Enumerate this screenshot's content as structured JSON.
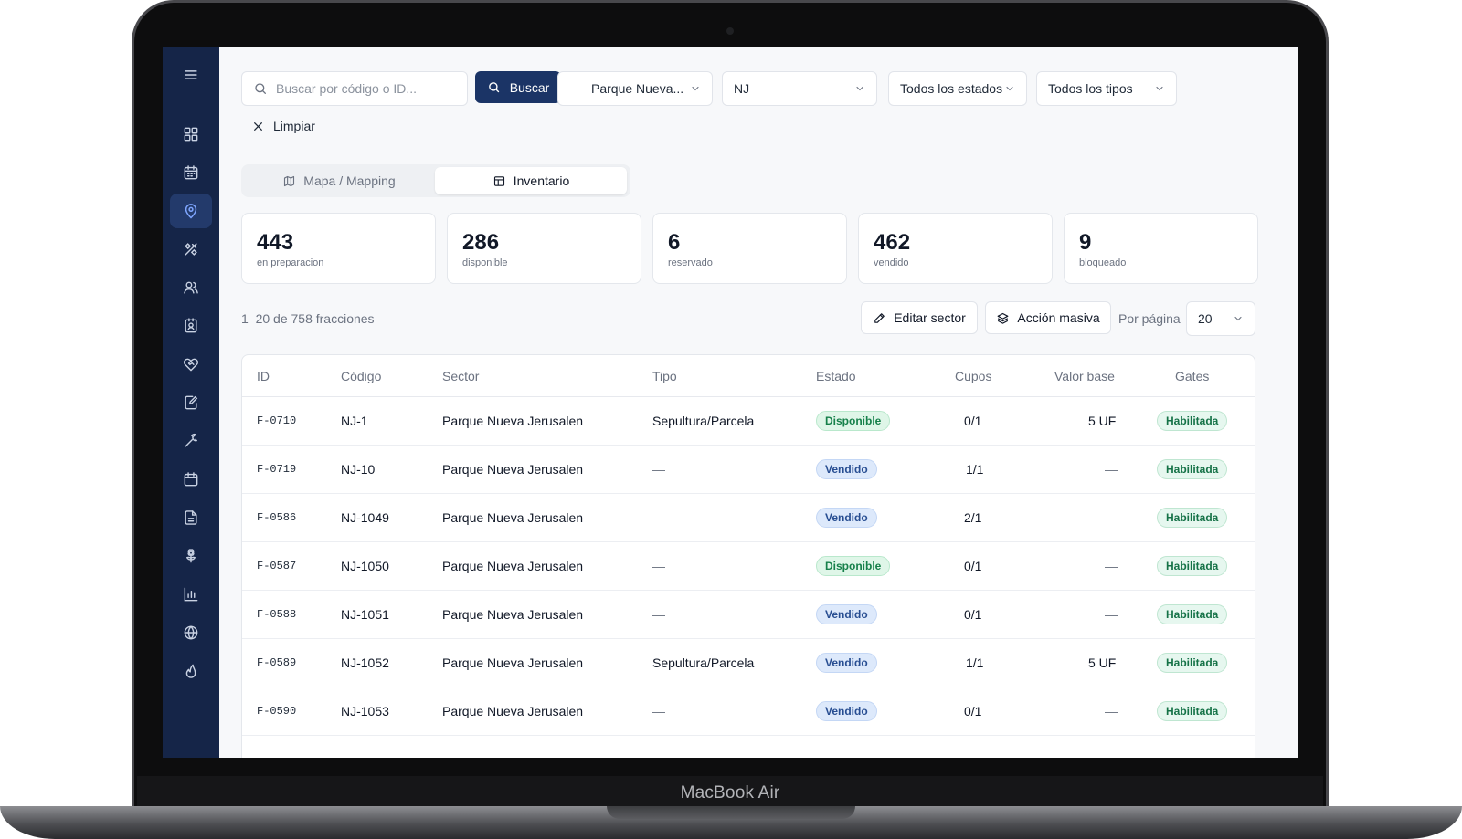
{
  "device": {
    "brand": "MacBook Air"
  },
  "sidebar": {
    "items": [
      {
        "name": "menu-icon"
      },
      {
        "name": "dashboard-icon"
      },
      {
        "name": "calendar-icon"
      },
      {
        "name": "map-pin-icon",
        "active": true
      },
      {
        "name": "tools-icon"
      },
      {
        "name": "users-icon"
      },
      {
        "name": "contact-card-icon"
      },
      {
        "name": "handshake-icon"
      },
      {
        "name": "edit-document-icon"
      },
      {
        "name": "wrench-icon"
      },
      {
        "name": "calendar-alt-icon"
      },
      {
        "name": "file-icon"
      },
      {
        "name": "flower-icon"
      },
      {
        "name": "bar-chart-icon"
      },
      {
        "name": "globe-icon"
      },
      {
        "name": "flame-icon"
      }
    ]
  },
  "filters": {
    "search_placeholder": "Buscar por código o ID...",
    "search_button": "Buscar",
    "park": "Parque Nueva...",
    "sector": "NJ",
    "status": "Todos los estados",
    "type": "Todos los tipos",
    "clear": "Limpiar"
  },
  "tabs": [
    {
      "label": "Mapa / Mapping",
      "active": false
    },
    {
      "label": "Inventario",
      "active": true
    }
  ],
  "stats": [
    {
      "value": "443",
      "label": "en preparacion"
    },
    {
      "value": "286",
      "label": "disponible"
    },
    {
      "value": "6",
      "label": "reservado"
    },
    {
      "value": "462",
      "label": "vendido"
    },
    {
      "value": "9",
      "label": "bloqueado"
    }
  ],
  "toolbar": {
    "count": "1–20 de 758 fracciones",
    "edit_sector": "Editar sector",
    "bulk_action": "Acción masiva",
    "per_page_label": "Por página",
    "per_page_value": "20"
  },
  "table": {
    "columns": [
      "ID",
      "Código",
      "Sector",
      "Tipo",
      "Estado",
      "Cupos",
      "Valor base",
      "Gates"
    ],
    "rows": [
      {
        "id": "F-0710",
        "code": "NJ-1",
        "sector": "Parque Nueva Jerusalen",
        "type": "Sepultura/Parcela",
        "status": "Disponible",
        "cupos": "0/1",
        "value": "5 UF",
        "gates": "Habilitada"
      },
      {
        "id": "F-0719",
        "code": "NJ-10",
        "sector": "Parque Nueva Jerusalen",
        "type": "—",
        "status": "Vendido",
        "cupos": "1/1",
        "value": "—",
        "gates": "Habilitada"
      },
      {
        "id": "F-0586",
        "code": "NJ-1049",
        "sector": "Parque Nueva Jerusalen",
        "type": "—",
        "status": "Vendido",
        "cupos": "2/1",
        "value": "—",
        "gates": "Habilitada"
      },
      {
        "id": "F-0587",
        "code": "NJ-1050",
        "sector": "Parque Nueva Jerusalen",
        "type": "—",
        "status": "Disponible",
        "cupos": "0/1",
        "value": "—",
        "gates": "Habilitada"
      },
      {
        "id": "F-0588",
        "code": "NJ-1051",
        "sector": "Parque Nueva Jerusalen",
        "type": "—",
        "status": "Vendido",
        "cupos": "0/1",
        "value": "—",
        "gates": "Habilitada"
      },
      {
        "id": "F-0589",
        "code": "NJ-1052",
        "sector": "Parque Nueva Jerusalen",
        "type": "Sepultura/Parcela",
        "status": "Vendido",
        "cupos": "1/1",
        "value": "5 UF",
        "gates": "Habilitada"
      },
      {
        "id": "F-0590",
        "code": "NJ-1053",
        "sector": "Parque Nueva Jerusalen",
        "type": "—",
        "status": "Vendido",
        "cupos": "0/1",
        "value": "—",
        "gates": "Habilitada"
      }
    ]
  },
  "colors": {
    "sidebar": "#152548",
    "primary": "#1b3466",
    "available": "#16804a",
    "sold": "#284e92",
    "enabled": "#157247"
  }
}
